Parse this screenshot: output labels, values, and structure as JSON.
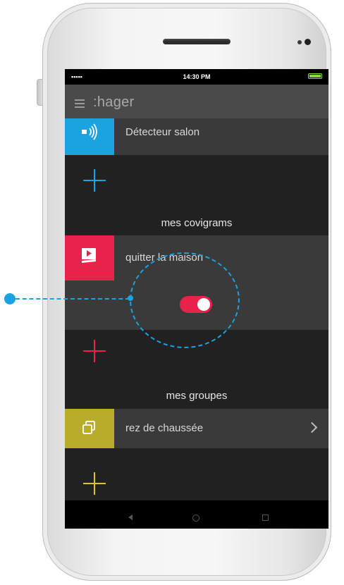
{
  "status_bar": {
    "signal": "▪▪▪▪▪",
    "time": "14:30 PM",
    "battery_level": 1.0
  },
  "app_bar": {
    "menu_icon": "hamburger-icon",
    "logo": ":hager"
  },
  "devices": {
    "item": {
      "label": "Détecteur salon",
      "icon": "motion-sensor-icon",
      "tile_color": "#1ba3e0"
    },
    "add_icon": "plus-icon",
    "add_color": "#1ba3e0"
  },
  "covigrams": {
    "title": "mes covigrams",
    "item": {
      "label": "quitter la maison",
      "icon": "scenario-play-icon",
      "tile_color": "#e8224a"
    },
    "toggle": {
      "state": "on",
      "color": "#e8224a"
    },
    "add_icon": "plus-icon",
    "add_color": "#e8224a"
  },
  "groups": {
    "title": "mes groupes",
    "item": {
      "label": "rez de chaussée",
      "icon": "group-squares-icon",
      "tile_color": "#b9ac2b",
      "chevron": "chevron-right-icon"
    },
    "add_icon": "plus-icon",
    "add_color": "#d8c62c"
  },
  "callout_color": "#1aa3e0"
}
